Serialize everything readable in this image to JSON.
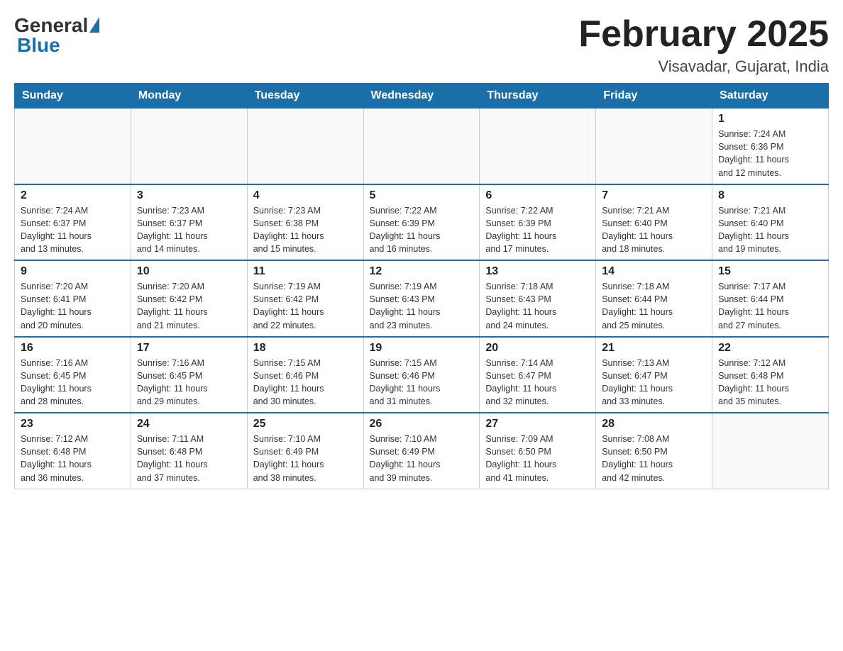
{
  "header": {
    "logo_general": "General",
    "logo_blue": "Blue",
    "month_title": "February 2025",
    "location": "Visavadar, Gujarat, India"
  },
  "days_of_week": [
    "Sunday",
    "Monday",
    "Tuesday",
    "Wednesday",
    "Thursday",
    "Friday",
    "Saturday"
  ],
  "weeks": [
    {
      "days": [
        {
          "num": "",
          "info": ""
        },
        {
          "num": "",
          "info": ""
        },
        {
          "num": "",
          "info": ""
        },
        {
          "num": "",
          "info": ""
        },
        {
          "num": "",
          "info": ""
        },
        {
          "num": "",
          "info": ""
        },
        {
          "num": "1",
          "info": "Sunrise: 7:24 AM\nSunset: 6:36 PM\nDaylight: 11 hours\nand 12 minutes."
        }
      ]
    },
    {
      "days": [
        {
          "num": "2",
          "info": "Sunrise: 7:24 AM\nSunset: 6:37 PM\nDaylight: 11 hours\nand 13 minutes."
        },
        {
          "num": "3",
          "info": "Sunrise: 7:23 AM\nSunset: 6:37 PM\nDaylight: 11 hours\nand 14 minutes."
        },
        {
          "num": "4",
          "info": "Sunrise: 7:23 AM\nSunset: 6:38 PM\nDaylight: 11 hours\nand 15 minutes."
        },
        {
          "num": "5",
          "info": "Sunrise: 7:22 AM\nSunset: 6:39 PM\nDaylight: 11 hours\nand 16 minutes."
        },
        {
          "num": "6",
          "info": "Sunrise: 7:22 AM\nSunset: 6:39 PM\nDaylight: 11 hours\nand 17 minutes."
        },
        {
          "num": "7",
          "info": "Sunrise: 7:21 AM\nSunset: 6:40 PM\nDaylight: 11 hours\nand 18 minutes."
        },
        {
          "num": "8",
          "info": "Sunrise: 7:21 AM\nSunset: 6:40 PM\nDaylight: 11 hours\nand 19 minutes."
        }
      ]
    },
    {
      "days": [
        {
          "num": "9",
          "info": "Sunrise: 7:20 AM\nSunset: 6:41 PM\nDaylight: 11 hours\nand 20 minutes."
        },
        {
          "num": "10",
          "info": "Sunrise: 7:20 AM\nSunset: 6:42 PM\nDaylight: 11 hours\nand 21 minutes."
        },
        {
          "num": "11",
          "info": "Sunrise: 7:19 AM\nSunset: 6:42 PM\nDaylight: 11 hours\nand 22 minutes."
        },
        {
          "num": "12",
          "info": "Sunrise: 7:19 AM\nSunset: 6:43 PM\nDaylight: 11 hours\nand 23 minutes."
        },
        {
          "num": "13",
          "info": "Sunrise: 7:18 AM\nSunset: 6:43 PM\nDaylight: 11 hours\nand 24 minutes."
        },
        {
          "num": "14",
          "info": "Sunrise: 7:18 AM\nSunset: 6:44 PM\nDaylight: 11 hours\nand 25 minutes."
        },
        {
          "num": "15",
          "info": "Sunrise: 7:17 AM\nSunset: 6:44 PM\nDaylight: 11 hours\nand 27 minutes."
        }
      ]
    },
    {
      "days": [
        {
          "num": "16",
          "info": "Sunrise: 7:16 AM\nSunset: 6:45 PM\nDaylight: 11 hours\nand 28 minutes."
        },
        {
          "num": "17",
          "info": "Sunrise: 7:16 AM\nSunset: 6:45 PM\nDaylight: 11 hours\nand 29 minutes."
        },
        {
          "num": "18",
          "info": "Sunrise: 7:15 AM\nSunset: 6:46 PM\nDaylight: 11 hours\nand 30 minutes."
        },
        {
          "num": "19",
          "info": "Sunrise: 7:15 AM\nSunset: 6:46 PM\nDaylight: 11 hours\nand 31 minutes."
        },
        {
          "num": "20",
          "info": "Sunrise: 7:14 AM\nSunset: 6:47 PM\nDaylight: 11 hours\nand 32 minutes."
        },
        {
          "num": "21",
          "info": "Sunrise: 7:13 AM\nSunset: 6:47 PM\nDaylight: 11 hours\nand 33 minutes."
        },
        {
          "num": "22",
          "info": "Sunrise: 7:12 AM\nSunset: 6:48 PM\nDaylight: 11 hours\nand 35 minutes."
        }
      ]
    },
    {
      "days": [
        {
          "num": "23",
          "info": "Sunrise: 7:12 AM\nSunset: 6:48 PM\nDaylight: 11 hours\nand 36 minutes."
        },
        {
          "num": "24",
          "info": "Sunrise: 7:11 AM\nSunset: 6:48 PM\nDaylight: 11 hours\nand 37 minutes."
        },
        {
          "num": "25",
          "info": "Sunrise: 7:10 AM\nSunset: 6:49 PM\nDaylight: 11 hours\nand 38 minutes."
        },
        {
          "num": "26",
          "info": "Sunrise: 7:10 AM\nSunset: 6:49 PM\nDaylight: 11 hours\nand 39 minutes."
        },
        {
          "num": "27",
          "info": "Sunrise: 7:09 AM\nSunset: 6:50 PM\nDaylight: 11 hours\nand 41 minutes."
        },
        {
          "num": "28",
          "info": "Sunrise: 7:08 AM\nSunset: 6:50 PM\nDaylight: 11 hours\nand 42 minutes."
        },
        {
          "num": "",
          "info": ""
        }
      ]
    }
  ]
}
